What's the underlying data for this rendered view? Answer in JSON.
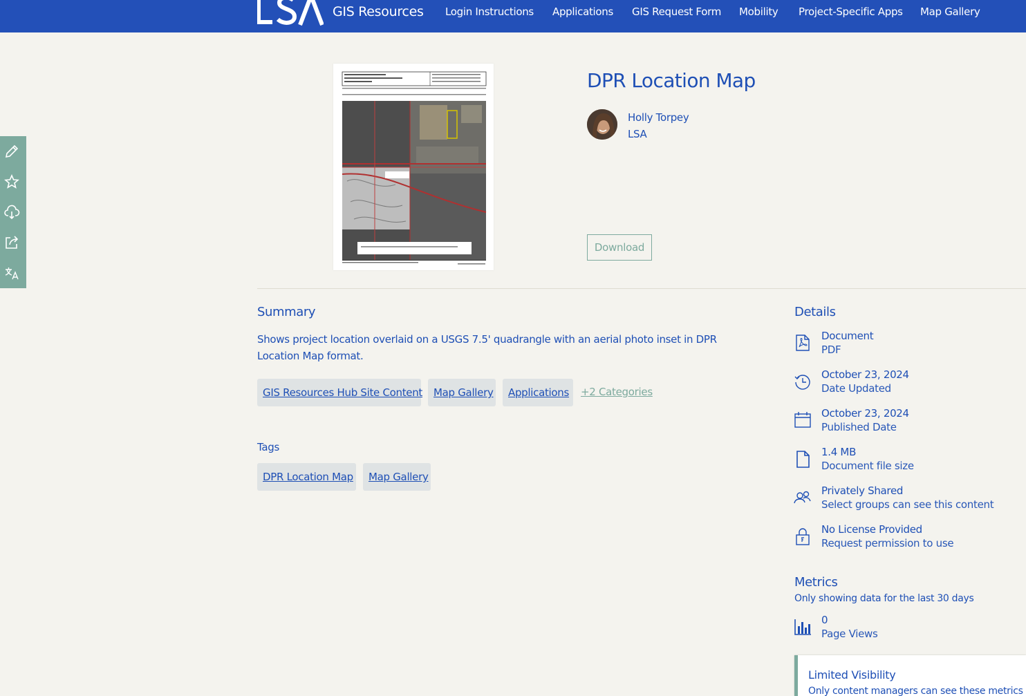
{
  "header": {
    "brand": "GIS Resources",
    "nav": [
      "Login Instructions",
      "Applications",
      "GIS Request Form",
      "Mobility",
      "Project-Specific Apps",
      "Map Gallery"
    ]
  },
  "sidebar": {
    "items": [
      "edit-icon",
      "favorite-icon",
      "cloud-download-icon",
      "share-icon",
      "translate-icon"
    ]
  },
  "item": {
    "title": "DPR Location Map",
    "author": "Holly Torpey",
    "org": "LSA",
    "download_label": "Download"
  },
  "summary": {
    "heading": "Summary",
    "text": "Shows project location overlaid on a USGS 7.5' quadrangle with an aerial photo inset in DPR Location Map format.",
    "categories": [
      "GIS Resources Hub Site Content",
      "Map Gallery",
      "Applications"
    ],
    "more_categories": "+2 Categories"
  },
  "tags": {
    "heading": "Tags",
    "items": [
      "DPR Location Map",
      "Map Gallery"
    ]
  },
  "details": {
    "heading": "Details",
    "rows": [
      {
        "value": "Document",
        "sub": "PDF",
        "icon": "pdf-icon"
      },
      {
        "value": "October 23, 2024",
        "sub": "Date Updated",
        "icon": "history-icon"
      },
      {
        "value": "October 23, 2024",
        "sub": "Published Date",
        "icon": "calendar-icon"
      },
      {
        "value": "1.4 MB",
        "sub": "Document file size",
        "icon": "file-icon"
      },
      {
        "value": "Privately Shared",
        "sub": "Select groups can see this content",
        "icon": "group-icon"
      },
      {
        "value": "No License Provided",
        "sub": "Request permission to use",
        "icon": "lock-icon"
      }
    ]
  },
  "metrics": {
    "heading": "Metrics",
    "note": "Only showing data for the last 30 days",
    "views_value": "0",
    "views_label": "Page Views",
    "limited_title": "Limited Visibility",
    "limited_text": "Only content managers can see these metrics"
  },
  "colors": {
    "header_bg": "#2350b8",
    "accent_green": "#7daa9e",
    "text_blue": "#1e4fb5",
    "page_bg": "#f4f3ee"
  }
}
